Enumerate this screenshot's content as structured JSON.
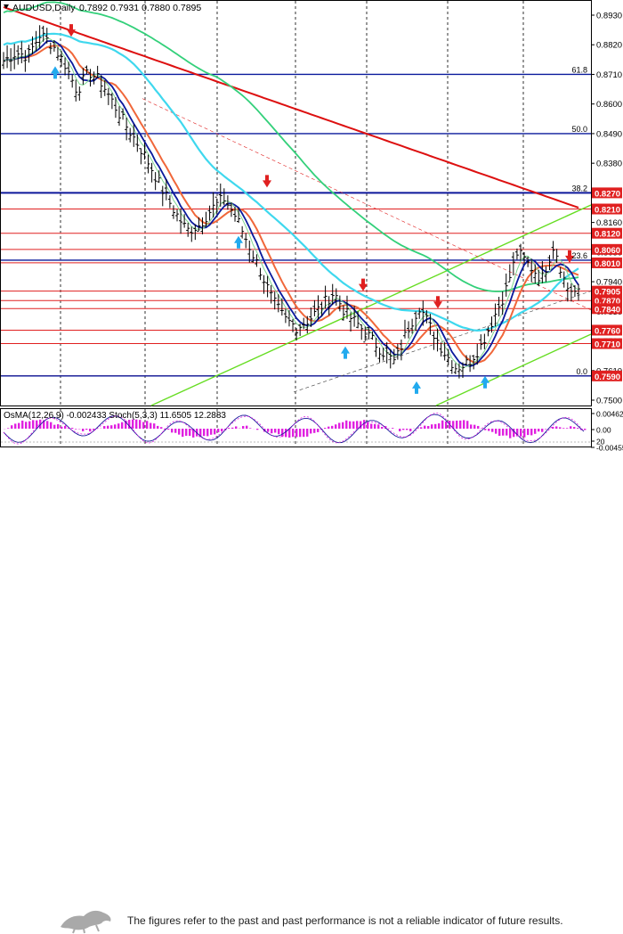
{
  "header": {
    "symbol": "AUDUSD,Daily",
    "ohlc": "0.7892 0.7931 0.7880 0.7895"
  },
  "price_axis": {
    "ticks": [
      "0.8930",
      "0.8820",
      "0.8710",
      "0.8600",
      "0.8490",
      "0.8380",
      "0.8270",
      "0.8160",
      "0.8050",
      "0.7940",
      "0.7830",
      "0.7720",
      "0.7610",
      "0.7500"
    ]
  },
  "fib_labels": [
    {
      "label": "61.8",
      "price": 0.871
    },
    {
      "label": "50.0",
      "price": 0.849
    },
    {
      "label": "38.2",
      "price": 0.827
    },
    {
      "label": "23.6",
      "price": 0.802
    },
    {
      "label": "0.0",
      "price": 0.759
    }
  ],
  "level_tags": [
    {
      "label": "0.8270",
      "price": 0.827,
      "bg": "#e02020"
    },
    {
      "label": "0.8210",
      "price": 0.821,
      "bg": "#e02020"
    },
    {
      "label": "0.8120",
      "price": 0.812,
      "bg": "#e02020"
    },
    {
      "label": "0.8060",
      "price": 0.806,
      "bg": "#e02020"
    },
    {
      "label": "0.8010",
      "price": 0.801,
      "bg": "#e02020"
    },
    {
      "label": "0.7905",
      "price": 0.7905,
      "bg": "#e02020"
    },
    {
      "label": "0.7870",
      "price": 0.787,
      "bg": "#e02020"
    },
    {
      "label": "0.7840",
      "price": 0.784,
      "bg": "#e02020"
    },
    {
      "label": "0.7760",
      "price": 0.776,
      "bg": "#e02020"
    },
    {
      "label": "0.7710",
      "price": 0.771,
      "bg": "#e02020"
    },
    {
      "label": "0.7590",
      "price": 0.759,
      "bg": "#e02020"
    }
  ],
  "indicator": {
    "title": "OsMA(12,26,9) -0.002433 Stoch(5,3,3) 11.6505 12.2883",
    "ticks": [
      "0.00462",
      "0.00",
      "20",
      "-0.00455"
    ]
  },
  "footer": {
    "disclaimer": "The figures refer to the past and past performance is not a reliable indicator of future results."
  },
  "colors": {
    "accent_red": "#e02020",
    "accent_blue": "#0a1a9c",
    "ma_aqua": "#3fd8ee",
    "ma_green": "#33d07a",
    "ma_red": "#dd1010",
    "fast_ma": "#f0673a",
    "trend_green": "#66dd22"
  },
  "chart_data": {
    "type": "line",
    "title": "AUDUSD,Daily",
    "ylim": [
      0.748,
      0.898
    ],
    "horizontal_levels": [
      0.827,
      0.821,
      0.812,
      0.806,
      0.801,
      0.7905,
      0.787,
      0.784,
      0.776,
      0.771,
      0.759
    ],
    "fibonacci": [
      {
        "level": "61.8",
        "price": 0.871
      },
      {
        "level": "50.0",
        "price": 0.849
      },
      {
        "level": "38.2",
        "price": 0.827
      },
      {
        "level": "23.6",
        "price": 0.802
      },
      {
        "level": "0.0",
        "price": 0.759
      }
    ],
    "close_path": [
      0.876,
      0.879,
      0.878,
      0.886,
      0.882,
      0.875,
      0.865,
      0.872,
      0.868,
      0.86,
      0.852,
      0.845,
      0.837,
      0.828,
      0.82,
      0.813,
      0.815,
      0.821,
      0.825,
      0.818,
      0.808,
      0.798,
      0.787,
      0.78,
      0.777,
      0.78,
      0.785,
      0.79,
      0.782,
      0.778,
      0.773,
      0.768,
      0.764,
      0.776,
      0.785,
      0.776,
      0.768,
      0.762,
      0.764,
      0.77,
      0.78,
      0.79,
      0.805,
      0.8,
      0.795,
      0.808,
      0.792,
      0.7895
    ]
  }
}
